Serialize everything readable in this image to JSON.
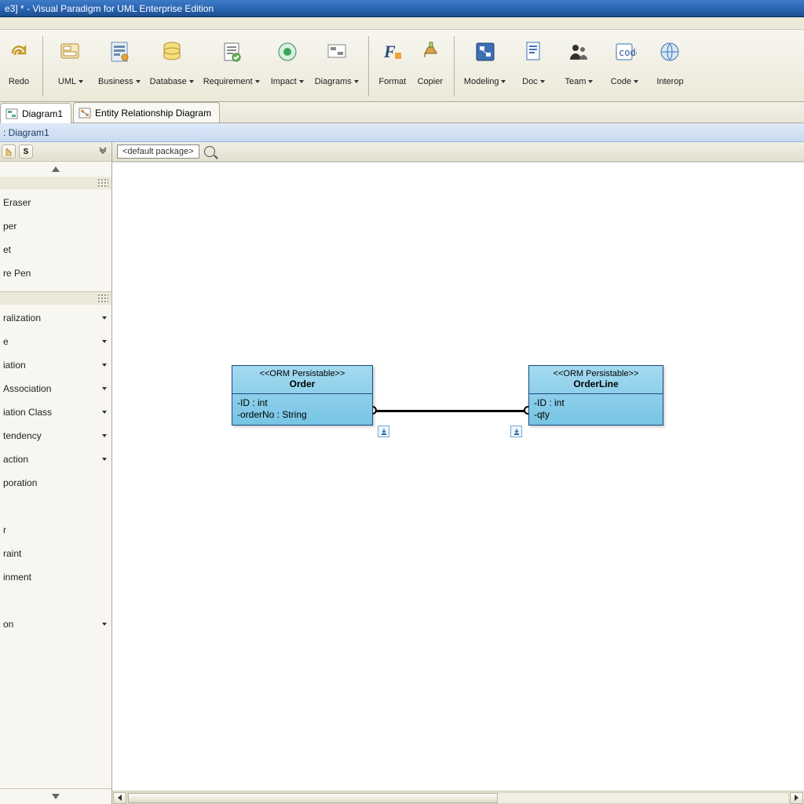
{
  "titlebar": "e3] * - Visual Paradigm for UML Enterprise Edition",
  "toolbar": {
    "redo": "Redo",
    "items": [
      "UML",
      "Business",
      "Database",
      "Requirement",
      "Impact",
      "Diagrams"
    ],
    "group2": [
      "Format",
      "Copier"
    ],
    "group3": [
      "Modeling",
      "Doc",
      "Team",
      "Code",
      "Interop"
    ]
  },
  "tabs": {
    "t1": "Diagram1",
    "t2": "Entity Relationship Diagram"
  },
  "crumb": ": Diagram1",
  "sidebar": {
    "mini_s": "S",
    "section1": [
      "Eraser",
      "per",
      "et",
      "re Pen"
    ],
    "section2": [
      "ralization",
      "e",
      "iation",
      "Association",
      "iation Class",
      "tendency",
      "action",
      "poration",
      "",
      "r",
      "raint",
      "inment",
      "",
      "on"
    ]
  },
  "canvas": {
    "package": "<default package>",
    "class1": {
      "stereo": "<<ORM Persistable>>",
      "name": "Order",
      "attrs": [
        "-ID : int",
        "-orderNo : String"
      ]
    },
    "class2": {
      "stereo": "<<ORM Persistable>>",
      "name": "OrderLine",
      "attrs": [
        "-ID : int",
        "-qty"
      ]
    }
  }
}
